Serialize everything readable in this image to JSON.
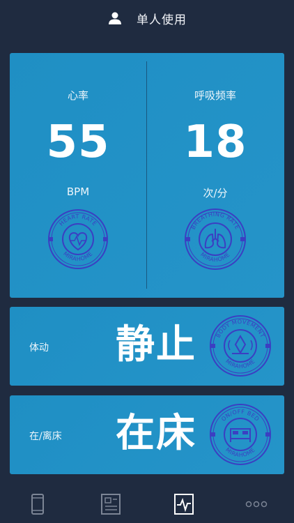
{
  "header": {
    "title": "单人使用",
    "icon": "person-icon"
  },
  "vitals": {
    "heart": {
      "label": "心率",
      "value": "55",
      "unit": "BPM",
      "badge_top": "HEART RATE",
      "badge_bottom": "MIRAHOME"
    },
    "breath": {
      "label": "呼吸频率",
      "value": "18",
      "unit": "次/分",
      "badge_top": "BREATHING RATE",
      "badge_bottom": "MIRAHOME"
    }
  },
  "body_movement": {
    "label": "体动",
    "value": "静止",
    "badge_top": "BODY MOVEMENT",
    "badge_bottom": "MIRAHOME"
  },
  "bed_status": {
    "label": "在/离床",
    "value": "在床",
    "badge_top": "ON/OFF BED",
    "badge_bottom": "MIRAHOME"
  },
  "tabbar": {
    "items": [
      {
        "icon": "phone-icon"
      },
      {
        "icon": "report-icon"
      },
      {
        "icon": "monitor-icon",
        "active": true
      },
      {
        "icon": "more-icon"
      }
    ]
  },
  "colors": {
    "background": "#1f2b40",
    "card": "#2192c7",
    "badge": "#3b3fc2"
  }
}
